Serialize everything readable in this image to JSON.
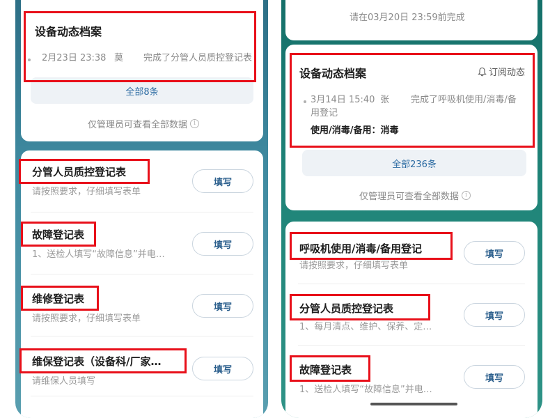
{
  "left": {
    "archive": {
      "title": "设备动态档案",
      "entry": {
        "time": "2月23日 23:38",
        "user": "莫",
        "action": "完成了分管人员质控登记表"
      },
      "all_label": "全部8条",
      "admin_note": "仅管理员可查看全部数据"
    },
    "forms": [
      {
        "title": "分管人员质控登记表",
        "desc": "请按照要求，仔细填写表单",
        "button": "填写"
      },
      {
        "title": "故障登记表",
        "desc": "1、送检人填写“故障信息”并电…",
        "button": "填写"
      },
      {
        "title": "维修登记表",
        "desc": "请按照要求，仔细填写表单",
        "button": "填写"
      },
      {
        "title": "维保登记表（设备科/厂家…",
        "desc": "请维保人员填写",
        "button": "填写"
      }
    ]
  },
  "right": {
    "deadline_notice": "请在03月20日 23:59前完成",
    "archive": {
      "title": "设备动态档案",
      "subscribe_label": "订阅动态",
      "entry": {
        "time": "3月14日 15:40",
        "user": "张",
        "action": "完成了呼吸机使用/消毒/备",
        "action_cont": "用登记",
        "detail": "使用/消毒/备用：消毒"
      },
      "all_label": "全部236条",
      "admin_note": "仅管理员可查看全部数据"
    },
    "forms": [
      {
        "title": "呼吸机使用/消毒/备用登记",
        "desc": "请按照要求，仔细填写表单",
        "button": "填写"
      },
      {
        "title": "分管人员质控登记表",
        "desc": "1、每月清点、维护、保养、定…",
        "button": "填写"
      },
      {
        "title": "故障登记表",
        "desc": "1、送检人填写“故障信息”并电…",
        "button": "填写"
      }
    ]
  },
  "icons": {
    "bell": "bell-icon",
    "info": "info-icon"
  },
  "colors": {
    "highlight": "#e8101a",
    "accent": "#2d6ca3",
    "left_bg": "#3f8aa0",
    "right_bg": "#1f8478"
  }
}
